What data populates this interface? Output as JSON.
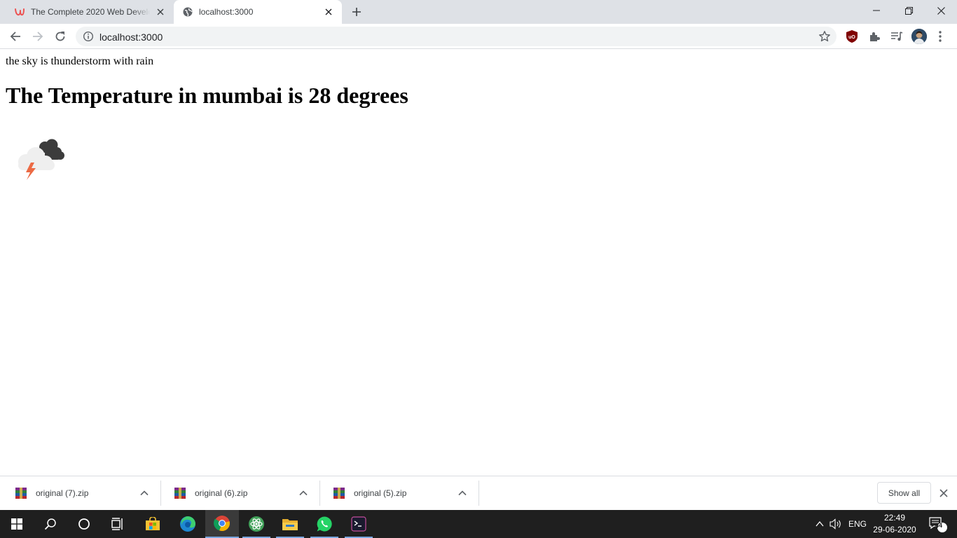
{
  "browser": {
    "tabs": [
      {
        "title": "The Complete 2020 Web Developer",
        "favicon": "udemy-icon",
        "active": false
      },
      {
        "title": "localhost:3000",
        "favicon": "globe-icon",
        "active": true
      }
    ],
    "address_bar": {
      "url": "localhost:3000"
    }
  },
  "page": {
    "description": "the sky is thunderstorm with rain",
    "temperature_heading": "The Temperature in mumbai is 28 degrees",
    "weather_icon": "thunderstorm-cloud-icon"
  },
  "downloads": {
    "items": [
      {
        "filename": "original (7).zip",
        "icon": "winrar-archive-icon"
      },
      {
        "filename": "original (6).zip",
        "icon": "winrar-archive-icon"
      },
      {
        "filename": "original (5).zip",
        "icon": "winrar-archive-icon"
      }
    ],
    "show_all_label": "Show all"
  },
  "taskbar": {
    "apps": [
      "windows-start-icon",
      "search-icon",
      "cortana-icon",
      "task-view-icon",
      "store-icon",
      "edge-icon",
      "chrome-icon",
      "atom-icon",
      "file-explorer-icon",
      "whatsapp-icon",
      "terminal-icon"
    ],
    "language": "ENG",
    "time": "22:49",
    "date": "29-06-2020",
    "notification_count": "44"
  },
  "colors": {
    "accent": "#7aa7e0",
    "tab_strip": "#dee1e6",
    "taskbar": "#1f1f1f"
  }
}
